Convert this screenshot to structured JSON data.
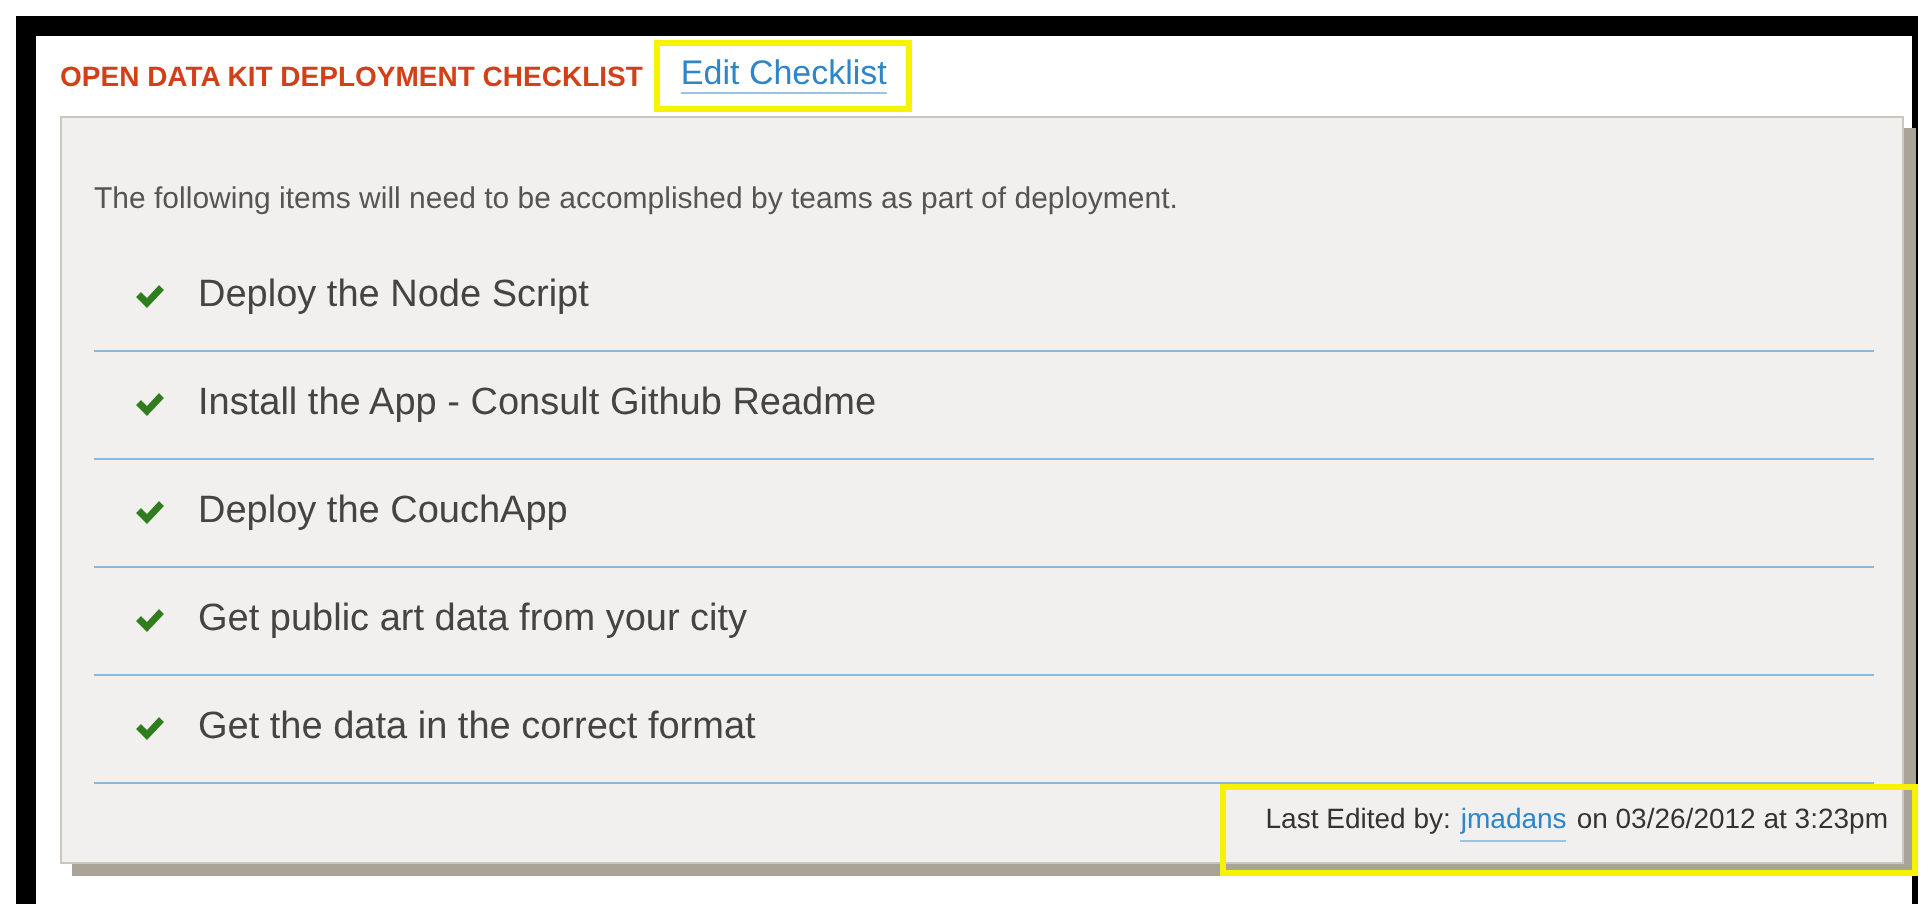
{
  "header": {
    "title": "OPEN DATA KIT DEPLOYMENT CHECKLIST",
    "edit_link": {
      "label": "Edit Checklist",
      "highlighted": true
    }
  },
  "intro": "The following items will need to be accomplished by teams as part of deployment.",
  "items": [
    {
      "label": "Deploy the Node Script",
      "checked": true
    },
    {
      "label": "Install the App - Consult Github Readme",
      "checked": true
    },
    {
      "label": "Deploy the CouchApp",
      "checked": true
    },
    {
      "label": "Get public art data from your city",
      "checked": true
    },
    {
      "label": "Get the data in the correct format",
      "checked": true
    }
  ],
  "footer": {
    "prefix": "Last Edited by:",
    "user": "jmadans",
    "suffix": "on 03/26/2012 at 3:23pm",
    "highlighted": true
  }
}
